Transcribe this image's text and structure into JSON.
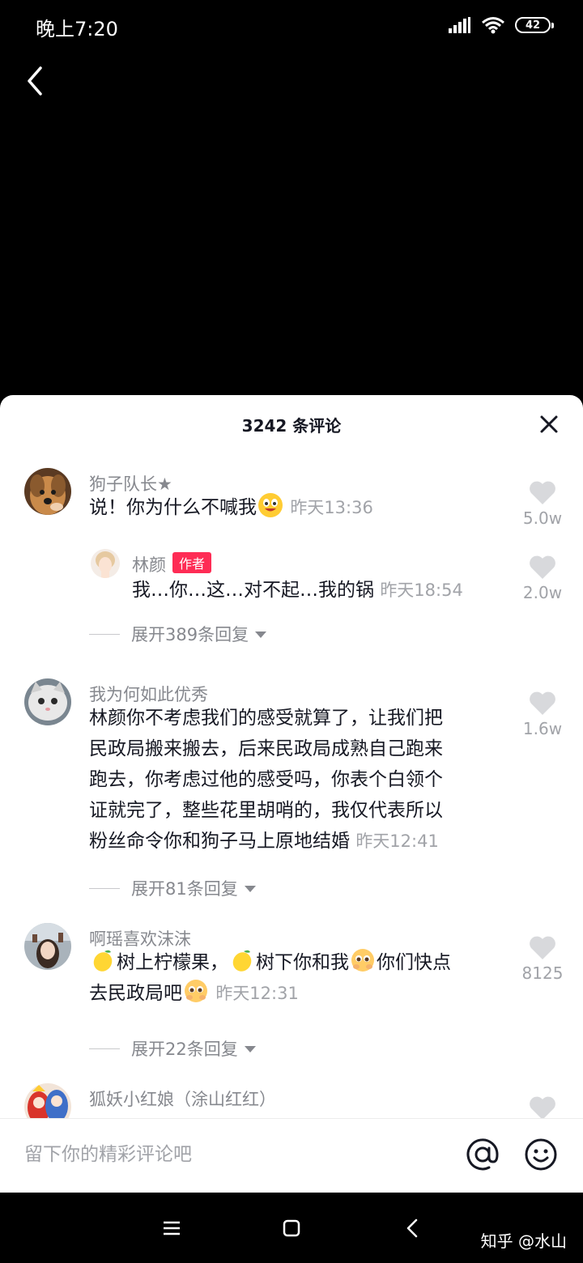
{
  "status_bar": {
    "time": "晚上7:20",
    "battery": "42",
    "signal_icon": "signal-bars-icon",
    "wifi_icon": "wifi-icon"
  },
  "comments_panel": {
    "title": "3242 条评论",
    "close_icon": "close-icon",
    "comments": [
      {
        "username": "狗子队长★",
        "text": "说！你为什么不喊我",
        "emoji": "grinning-face",
        "time": "昨天13:36",
        "likes": "5.0w",
        "reply": {
          "username": "林颜",
          "badge": "作者",
          "text": "我…你…这…对不起…我的锅",
          "time": "昨天18:54",
          "likes": "2.0w"
        },
        "expand": "展开389条回复"
      },
      {
        "username": "我为何如此优秀",
        "lines": [
          "林颜你不考虑我们的感受就算了，让我们把",
          "民政局搬来搬去，后来民政局成熟自己跑来",
          "跑去，你考虑过他的感受吗，你表个白领个",
          "证就完了，整些花里胡哨的，我仅代表所以",
          "粉丝命令你和狗子马上原地结婚"
        ],
        "time": "昨天12:41",
        "likes": "1.6w",
        "expand": "展开81条回复"
      },
      {
        "username": "啊瑶喜欢沫沫",
        "segments": [
          "树上柠檬果，",
          "树下你和我",
          "你们快点"
        ],
        "line2": "去民政局吧",
        "emojis": [
          "lemon",
          "lemon",
          "pleading-face",
          "pleading-face"
        ],
        "time": "昨天12:31",
        "likes": "8125",
        "expand": "展开22条回复"
      },
      {
        "username": "狐妖小红娘（涂山红红）"
      }
    ]
  },
  "input_bar": {
    "placeholder": "留下你的精彩评论吧",
    "at_icon": "at-sign-icon",
    "emoji_icon": "smiley-icon"
  },
  "nav_bar": {
    "watermark": "知乎 @水山"
  },
  "colors": {
    "accent": "#fe2c55",
    "muted_text": "#86888e",
    "time_text": "#a1a3a8"
  }
}
